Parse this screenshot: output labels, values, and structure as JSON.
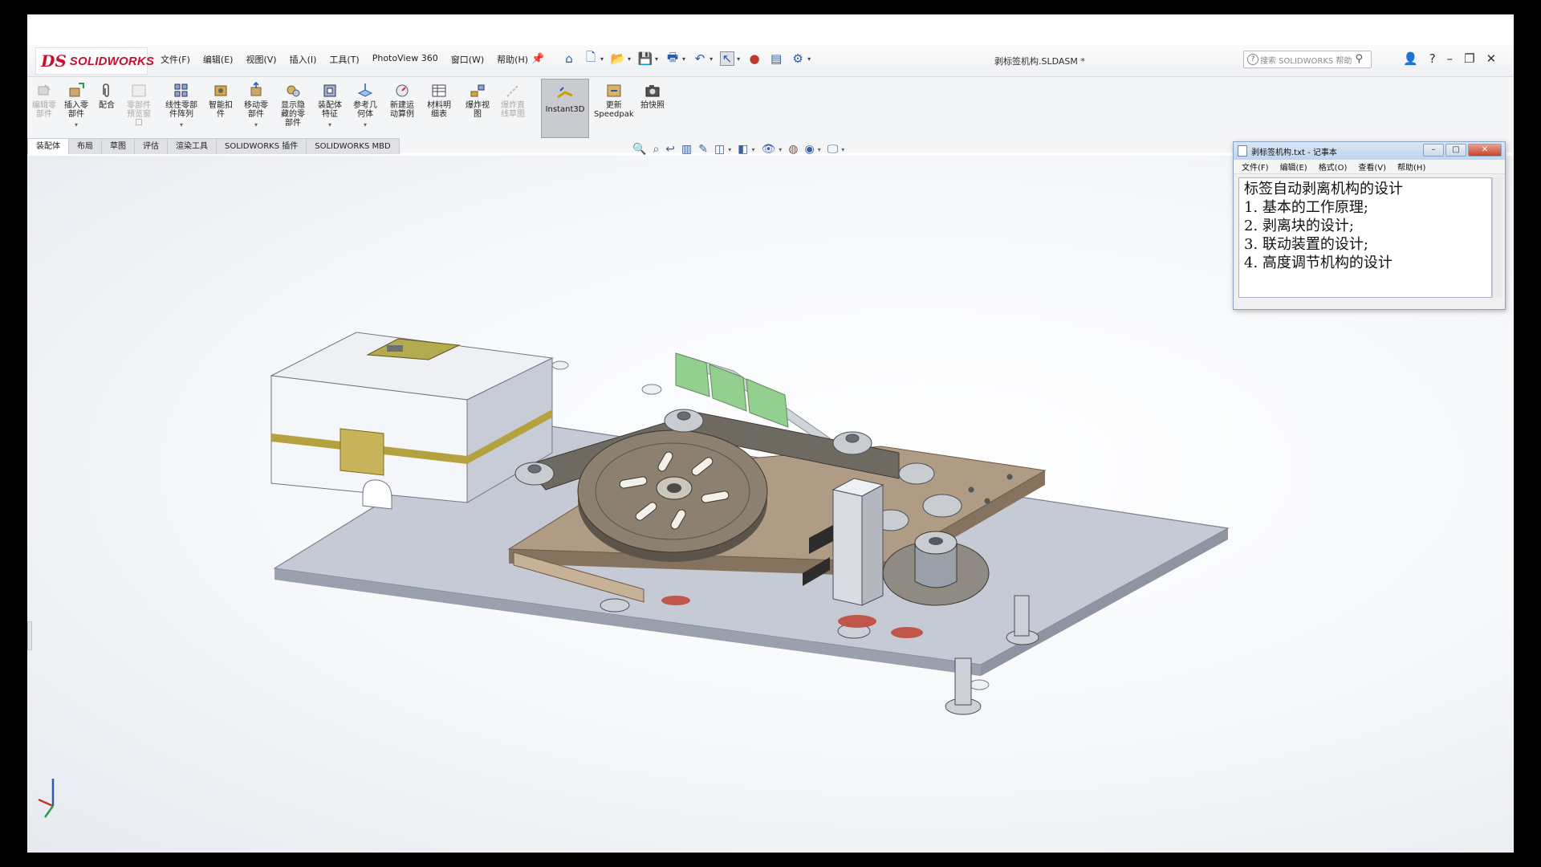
{
  "app": {
    "logo_ds": "DS",
    "logo_name": "SOLIDWORKS",
    "document_title": "剥标签机构.SLDASM *"
  },
  "menu": [
    "文件(F)",
    "编辑(E)",
    "视图(V)",
    "插入(I)",
    "工具(T)",
    "PhotoView 360",
    "窗口(W)",
    "帮助(H)"
  ],
  "search": {
    "placeholder": "搜索 SOLIDWORKS 帮助"
  },
  "ribbon": {
    "edit_component": "编辑零\n部件",
    "insert_component": "插入零\n部件",
    "mate": "配合",
    "component_preview": "零部件\n预览窗\n口",
    "linear_pattern": "线性零部\n件阵列",
    "smart_fasteners": "智能扣\n件",
    "move_component": "移动零\n部件",
    "show_hidden": "显示隐\n藏的零\n部件",
    "assembly_feature": "装配体\n特征",
    "reference_geometry": "参考几\n何体",
    "new_motion_study": "新建运\n动算例",
    "bom": "材料明\n细表",
    "exploded_view": "爆炸视\n图",
    "explode_line": "爆炸直\n线草图",
    "instant3d": "Instant3D",
    "speedpak_update": "更新",
    "speedpak": "Speedpak",
    "snapshot": "拍快照"
  },
  "tabs": [
    "装配体",
    "布局",
    "草图",
    "评估",
    "渲染工具",
    "SOLIDWORKS 插件",
    "SOLIDWORKS MBD"
  ],
  "active_tab": 0,
  "notepad": {
    "title": "剥标签机构.txt - 记事本",
    "menu": [
      "文件(F)",
      "编辑(E)",
      "格式(O)",
      "查看(V)",
      "帮助(H)"
    ],
    "lines": [
      "标签自动剥离机构的设计",
      "1. 基本的工作原理;",
      "2. 剥离块的设计;",
      "3. 联动装置的设计;",
      "4. 高度调节机构的设计"
    ]
  },
  "colors": {
    "brand_red": "#c8102e",
    "accent_blue": "#2a5ca9",
    "plate": "#c3c8d4",
    "bracket": "#9b8670",
    "label_green": "#8fcf8a",
    "pcb": "#b8a55a"
  }
}
